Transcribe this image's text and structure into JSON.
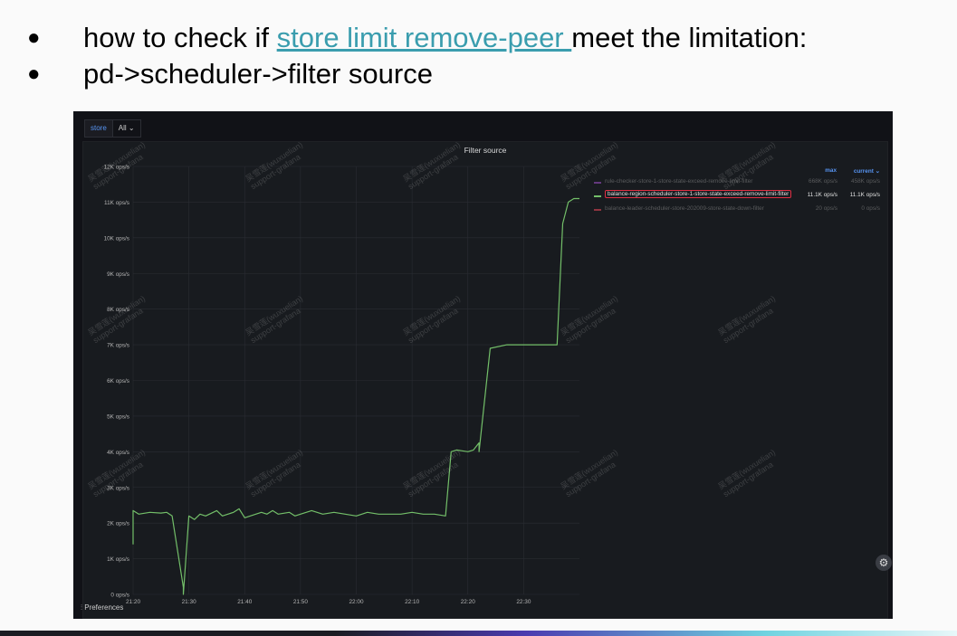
{
  "slide": {
    "bullet1": {
      "marker": "●",
      "before": "how to check if ",
      "link": "store limit remove-peer ",
      "after": " meet the limitation:"
    },
    "bullet2": {
      "marker": "●",
      "text": "pd->scheduler->filter source"
    }
  },
  "dashboard": {
    "variable_label": "store",
    "variable_value": "All",
    "dropdown_caret": "⌄",
    "panel_title": "Filter source",
    "preferences_label": "Preferences",
    "preferences_icon_glyph": "⫶",
    "settings_icon_glyph": "⚙",
    "watermark": {
      "line1": "吴雪莲(wuxuelian)",
      "line2": "support-grafana"
    },
    "legend": {
      "col_max": "max",
      "col_current": "current ⌄",
      "rows": [
        {
          "name": "rule-checker-store-1-store-state-exceed-remove-limit-filter",
          "max": "668K ops/s",
          "current": "458K ops/s",
          "color": "#a352cc",
          "dimmed": true,
          "highlighted": false
        },
        {
          "name": "balance-region-scheduler-store-1-store-state-exceed-remove-limit-filter",
          "max": "11.1K ops/s",
          "current": "11.1K ops/s",
          "color": "#73bf69",
          "dimmed": false,
          "highlighted": true
        },
        {
          "name": "balance-leader-scheduler-store-202009-store-state-down-filter",
          "max": "20 ops/s",
          "current": "0 ops/s",
          "color": "#f2495c",
          "dimmed": true,
          "highlighted": false
        }
      ]
    }
  },
  "chart_data": {
    "type": "line",
    "title": "Filter source",
    "xlabel": "",
    "ylabel": "",
    "ylim": [
      0,
      12000
    ],
    "y_ticks": [
      "0 ops/s",
      "1K ops/s",
      "2K ops/s",
      "3K ops/s",
      "4K ops/s",
      "5K ops/s",
      "6K ops/s",
      "7K ops/s",
      "8K ops/s",
      "9K ops/s",
      "10K ops/s",
      "11K ops/s",
      "12K ops/s"
    ],
    "x_ticks": [
      "21:20",
      "21:30",
      "21:40",
      "21:50",
      "22:00",
      "22:10",
      "22:20",
      "22:30"
    ],
    "x_range": [
      "21:20",
      "22:40"
    ],
    "grid": true,
    "legend_position": "top-right",
    "series": [
      {
        "name": "balance-region-scheduler-store-1-store-state-exceed-remove-limit-filter",
        "color": "#73bf69",
        "x": [
          "21:20",
          "21:20",
          "21:21",
          "21:23",
          "21:25",
          "21:26",
          "21:27",
          "21:29",
          "21:29",
          "21:30",
          "21:31",
          "21:32",
          "21:33",
          "21:35",
          "21:36",
          "21:38",
          "21:39",
          "21:40",
          "21:41",
          "21:43",
          "21:44",
          "21:45",
          "21:46",
          "21:48",
          "21:49",
          "21:50",
          "21:52",
          "21:54",
          "21:56",
          "21:58",
          "22:00",
          "22:02",
          "22:04",
          "22:06",
          "22:08",
          "22:10",
          "22:12",
          "22:14",
          "22:16",
          "22:17",
          "22:18",
          "22:20",
          "22:21",
          "22:22",
          "22:22",
          "22:24",
          "22:27",
          "22:29",
          "22:32",
          "22:34",
          "22:36",
          "22:37",
          "22:38",
          "22:39",
          "22:40"
        ],
        "y": [
          1400,
          2350,
          2250,
          2300,
          2280,
          2300,
          2200,
          200,
          0,
          2200,
          2100,
          2250,
          2200,
          2350,
          2200,
          2300,
          2400,
          2150,
          2200,
          2300,
          2250,
          2350,
          2250,
          2300,
          2200,
          2250,
          2350,
          2250,
          2300,
          2250,
          2200,
          2300,
          2250,
          2250,
          2250,
          2300,
          2250,
          2250,
          2200,
          4000,
          4050,
          4000,
          4050,
          4250,
          4000,
          6900,
          7000,
          7000,
          7000,
          7000,
          7000,
          10400,
          11000,
          11100,
          11100
        ]
      }
    ]
  }
}
